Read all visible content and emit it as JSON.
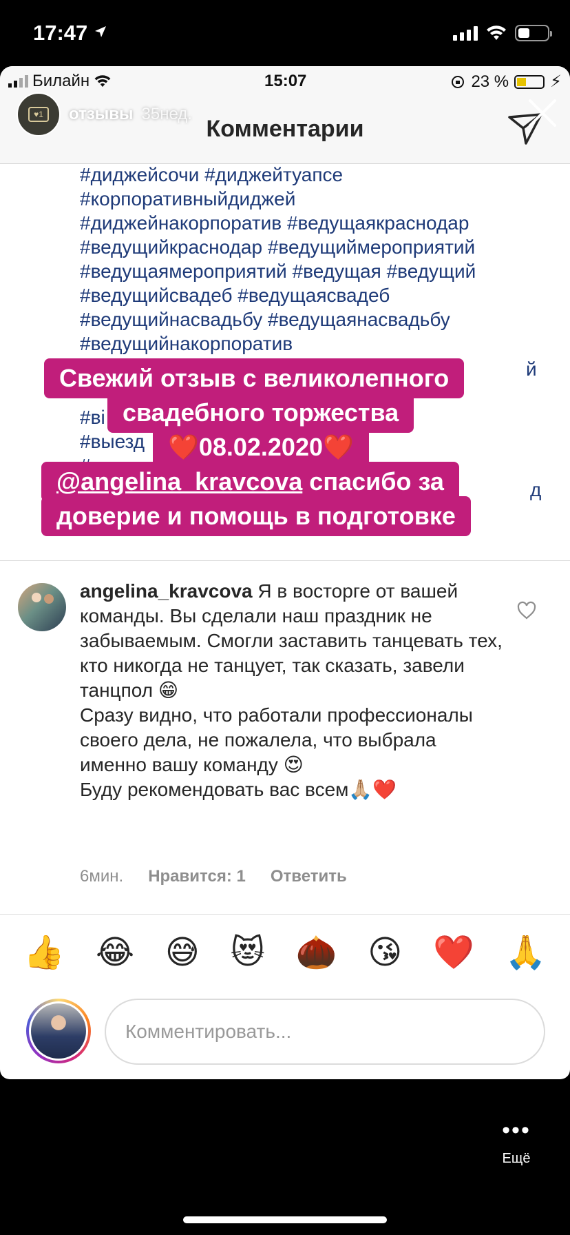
{
  "status_bar": {
    "time": "17:47"
  },
  "inner_status": {
    "carrier": "Билайн",
    "time": "15:07",
    "battery": "23 %"
  },
  "story": {
    "account": "отзывы",
    "age": "35нед."
  },
  "inner_header": {
    "title": "Комментарии"
  },
  "hashtags": [
    "#диджейсочи #диджейтуапсе",
    "#корпоративныйдиджей",
    "#диджейнакорпоратив #ведущаякраснодар",
    "#ведущийкраснодар #ведущиймероприятий",
    "#ведущаямероприятий #ведущая #ведущий",
    "#ведущийсвадеб #ведущаясвадеб",
    "#ведущийнасвадьбу #ведущаянасвадьбу",
    "#ведущийнакорпоратив"
  ],
  "hidden_fragments": [
    "й",
    "#ві",
    "#выезд",
    "#свадє",
    "д"
  ],
  "stickers": {
    "line1": "Свежий отзыв с великолепного",
    "line2": "свадебного торжества",
    "line3": "❤️08.02.2020❤️",
    "mention": "@angelina_kravcova",
    "line4_rest": " спасибо за",
    "line5": "доверие и помощь в подготовке"
  },
  "comment": {
    "username": "angelina_kravcova",
    "text_part1": " Я в восторге от вашей команды. Вы сделали наш праздник не забываемым. Смогли заставить танцевать тех, кто никогда не танцует, так сказать, завели танцпол 😁",
    "text_part2": "Сразу видно, что работали профессионалы своего дела, не пожалела, что выбрала именно вашу команду 😍",
    "text_part3": "Буду рекомендовать вас всем🙏🏼❤️",
    "time": "6мин.",
    "likes": "Нравится: 1",
    "reply": "Ответить"
  },
  "emoji_bar": [
    "👍",
    "😂",
    "😅",
    "😻",
    "🌰",
    "😘",
    "❤️",
    "🙏"
  ],
  "comment_input": {
    "placeholder": "Комментировать..."
  },
  "more": {
    "label": "Ещё"
  }
}
